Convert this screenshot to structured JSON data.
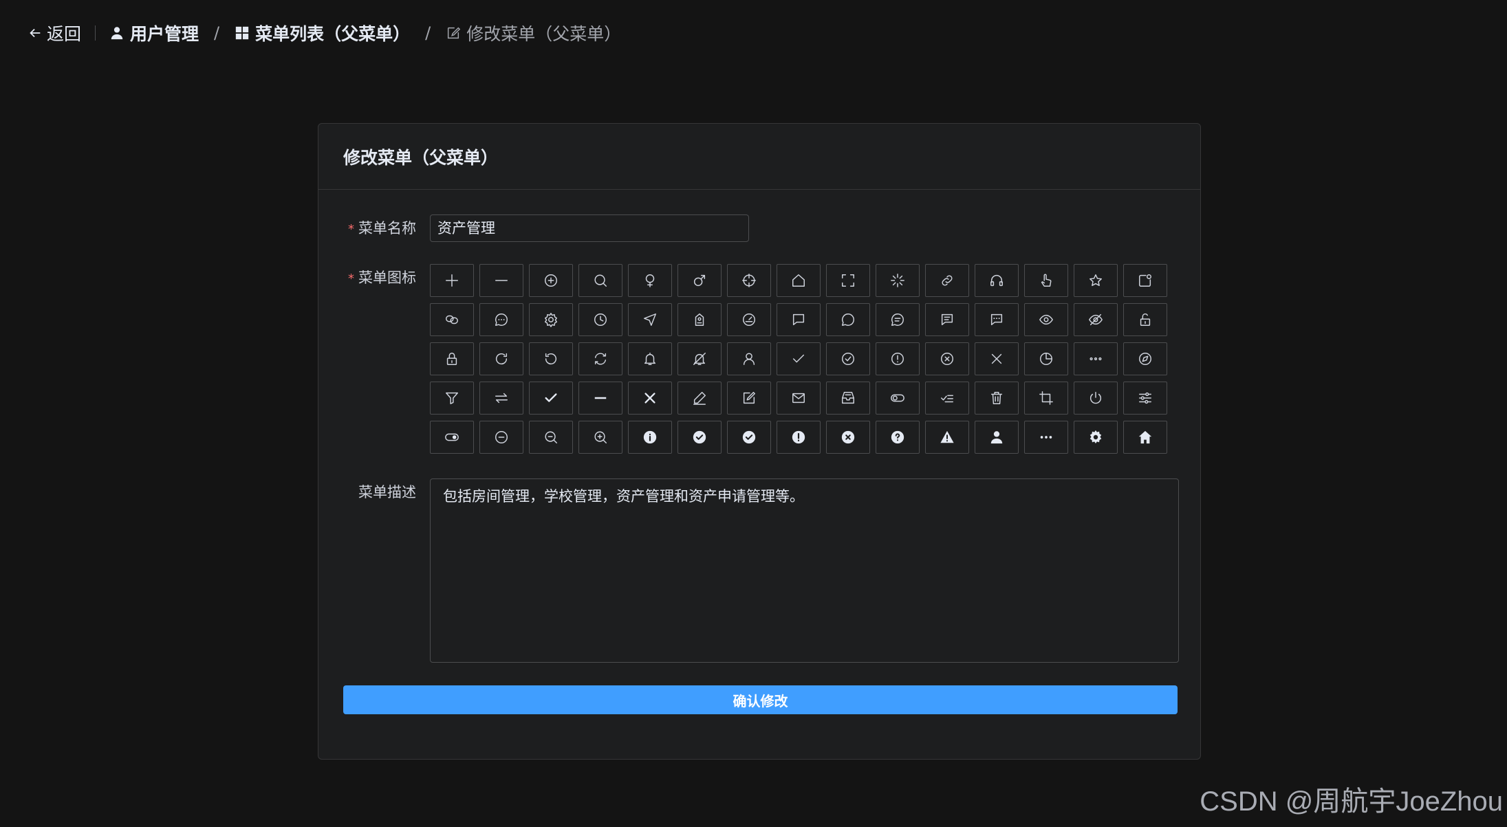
{
  "breadcrumb": {
    "back_label": "返回",
    "items": [
      {
        "label": "用户管理",
        "icon": "user-icon"
      },
      {
        "label": "菜单列表（父菜单）",
        "icon": "grid-icon"
      },
      {
        "label": "修改菜单（父菜单）",
        "icon": "edit-icon"
      }
    ],
    "separator": "/"
  },
  "card": {
    "title": "修改菜单（父菜单）",
    "required_mark": "*",
    "name_label": "菜单名称",
    "name_value": "资产管理",
    "icon_label": "菜单图标",
    "icons": [
      "plus-icon",
      "minus-icon",
      "circle-plus-icon",
      "search-icon",
      "female-icon",
      "male-icon",
      "aim-icon",
      "house-icon",
      "full-screen-icon",
      "loading-icon",
      "link-icon",
      "service-icon",
      "pointer-icon",
      "star-icon",
      "notification-icon",
      "connection-icon",
      "chat-dot-round-icon",
      "setting-icon",
      "clock-icon",
      "position-icon",
      "discount-icon",
      "odometer-icon",
      "chat-square-icon",
      "chat-round-icon",
      "chat-line-round-icon",
      "chat-line-square-icon",
      "chat-dot-square-icon",
      "view-icon",
      "hide-icon",
      "unlock-icon",
      "lock-icon",
      "refresh-right-icon",
      "refresh-left-icon",
      "refresh-icon",
      "bell-icon",
      "mute-notification-icon",
      "user-icon",
      "check-icon",
      "circle-check-icon",
      "warning-icon",
      "circle-close-icon",
      "close-icon",
      "pie-chart-icon",
      "more-icon",
      "compass-icon",
      "filter-icon",
      "switch-icon",
      "select-icon",
      "semi-select-icon",
      "close-bold-icon",
      "edit-pen-icon",
      "edit-icon",
      "message-icon",
      "message-box-icon",
      "turn-off-icon",
      "finished-icon",
      "delete-icon",
      "crop-icon",
      "switch-button-icon",
      "operation-icon",
      "open-icon",
      "remove-icon",
      "zoom-out-icon",
      "zoom-in-icon",
      "info-filled-icon",
      "circle-check-filled-icon",
      "success-filled-icon",
      "warning-filled-icon",
      "circle-close-filled-icon",
      "question-filled-icon",
      "warn-triangle-filled-icon",
      "user-filled-icon",
      "more-filled-icon",
      "tools-icon",
      "home-filled-icon"
    ],
    "desc_label": "菜单描述",
    "desc_value": "包括房间管理，学校管理，资产管理和资产申请管理等。",
    "submit_label": "确认修改"
  },
  "watermark": "CSDN @周航宇JoeZhou",
  "colors": {
    "background": "#141414",
    "card": "#1d1e1f",
    "border": "#4c4d4f",
    "primary": "#409eff",
    "required": "#f56c6c"
  }
}
